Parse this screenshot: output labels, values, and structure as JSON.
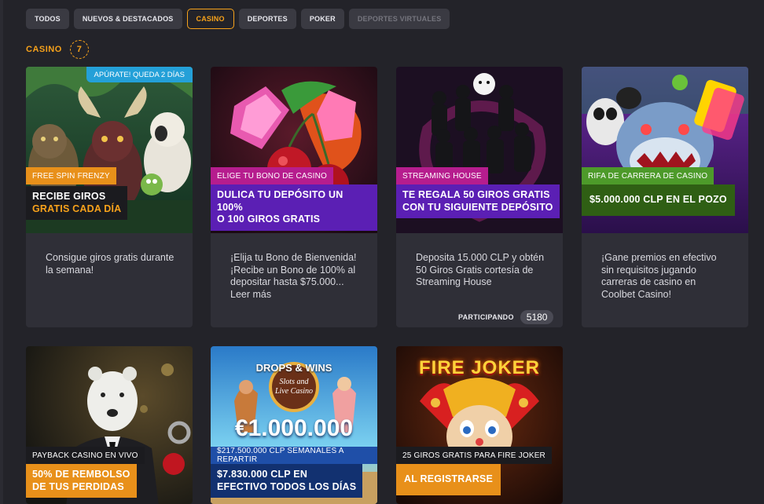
{
  "filters": [
    {
      "label": "TODOS",
      "state": "normal"
    },
    {
      "label": "NUEVOS & DESTACADOS",
      "state": "normal"
    },
    {
      "label": "CASINO",
      "state": "active"
    },
    {
      "label": "DEPORTES",
      "state": "normal"
    },
    {
      "label": "POKER",
      "state": "normal"
    },
    {
      "label": "DEPORTES VIRTUALES",
      "state": "disabled"
    }
  ],
  "section": {
    "title": "CASINO",
    "count": "7"
  },
  "colors": {
    "accent": "#f7a21b",
    "background": "#232329",
    "card": "#2f2f37"
  },
  "cards": [
    {
      "ribbon": "APÚRATE! QUEDA 2 DÍAS",
      "tag": "FREE SPIN FRENZY",
      "banner_line1": "RECIBE GIROS",
      "banner_line2": "GRATIS CADA DÍA",
      "description": "Consigue giros gratis durante la semana!"
    },
    {
      "tag": "ELIGE TU BONO DE CASINO",
      "banner_line1": "DULICA TU DEPÓSITO UN 100%",
      "banner_line2": "O 100 GIROS GRATIS",
      "description": "¡Elija tu Bono de Bienvenida! ¡Recibe un Bono de 100% al depositar hasta $75.000... Leer más"
    },
    {
      "tag": "STREAMING HOUSE",
      "banner_line1": "TE REGALA 50 GIROS GRATIS",
      "banner_line2": "CON TU SIGUIENTE DEPÓSITO",
      "description": "Deposita 15.000 CLP y obtén 50 Giros Gratis cortesía de Streaming House",
      "participating_label": "PARTICIPANDO",
      "participating_count": "5180"
    },
    {
      "tag": "RIFA DE CARRERA DE CASINO",
      "banner_line1": "$5.000.000 CLP EN EL POZO",
      "description": "¡Gane premios en efectivo sin requisitos jugando carreras de casino en Coolbet Casino!"
    },
    {
      "tag": "PAYBACK CASINO EN VIVO",
      "banner_line1": "50% DE REMBOLSO",
      "banner_line2": "DE TUS PERDIDAS"
    },
    {
      "art_title": "DROPS & WINS",
      "art_subtitle_1": "Slots and",
      "art_subtitle_2": "Live Casino",
      "art_prize": "€1.000.000",
      "tag": "$217.500.000 CLP SEMANALES A REPARTIR",
      "banner_line1": "$7.830.000 CLP EN",
      "banner_line2": "EFECTIVO TODOS LOS DÍAS"
    },
    {
      "art_title": "FIRE JOKER",
      "tag": "25 GIROS GRATIS PARA FIRE JOKER",
      "banner_line1": "AL REGISTRARSE"
    }
  ]
}
